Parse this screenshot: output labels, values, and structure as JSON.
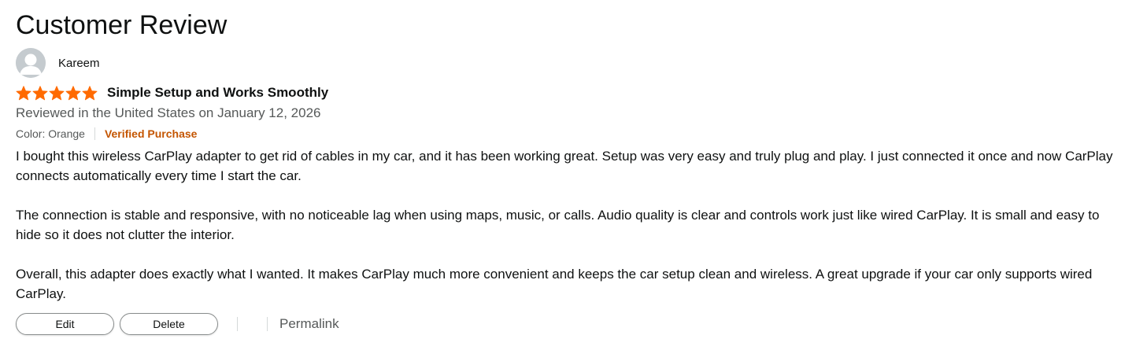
{
  "page": {
    "title": "Customer Review"
  },
  "reviewer": {
    "name": "Kareem",
    "avatar_icon": "user-silhouette-icon"
  },
  "review": {
    "rating": 5,
    "rating_max": 5,
    "star_color": "#ff6a00",
    "title": "Simple Setup and Works Smoothly",
    "date_line": "Reviewed in the United States on January 12, 2026",
    "color_option": "Color: Orange",
    "verified_label": "Verified Purchase",
    "verified_color": "#c45500",
    "paragraphs": [
      "I bought this wireless CarPlay adapter to get rid of cables in my car, and it has been working great. Setup was very easy and truly plug and play. I just connected it once and now CarPlay connects automatically every time I start the car.",
      "The connection is stable and responsive, with no noticeable lag when using maps, music, or calls. Audio quality is clear and controls work just like wired CarPlay. It is small and easy to hide so it does not clutter the interior.",
      "Overall, this adapter does exactly what I wanted. It makes CarPlay much more convenient and keeps the car setup clean and wireless. A great upgrade if your car only supports wired CarPlay."
    ]
  },
  "actions": {
    "edit_label": "Edit",
    "delete_label": "Delete",
    "permalink_label": "Permalink"
  }
}
